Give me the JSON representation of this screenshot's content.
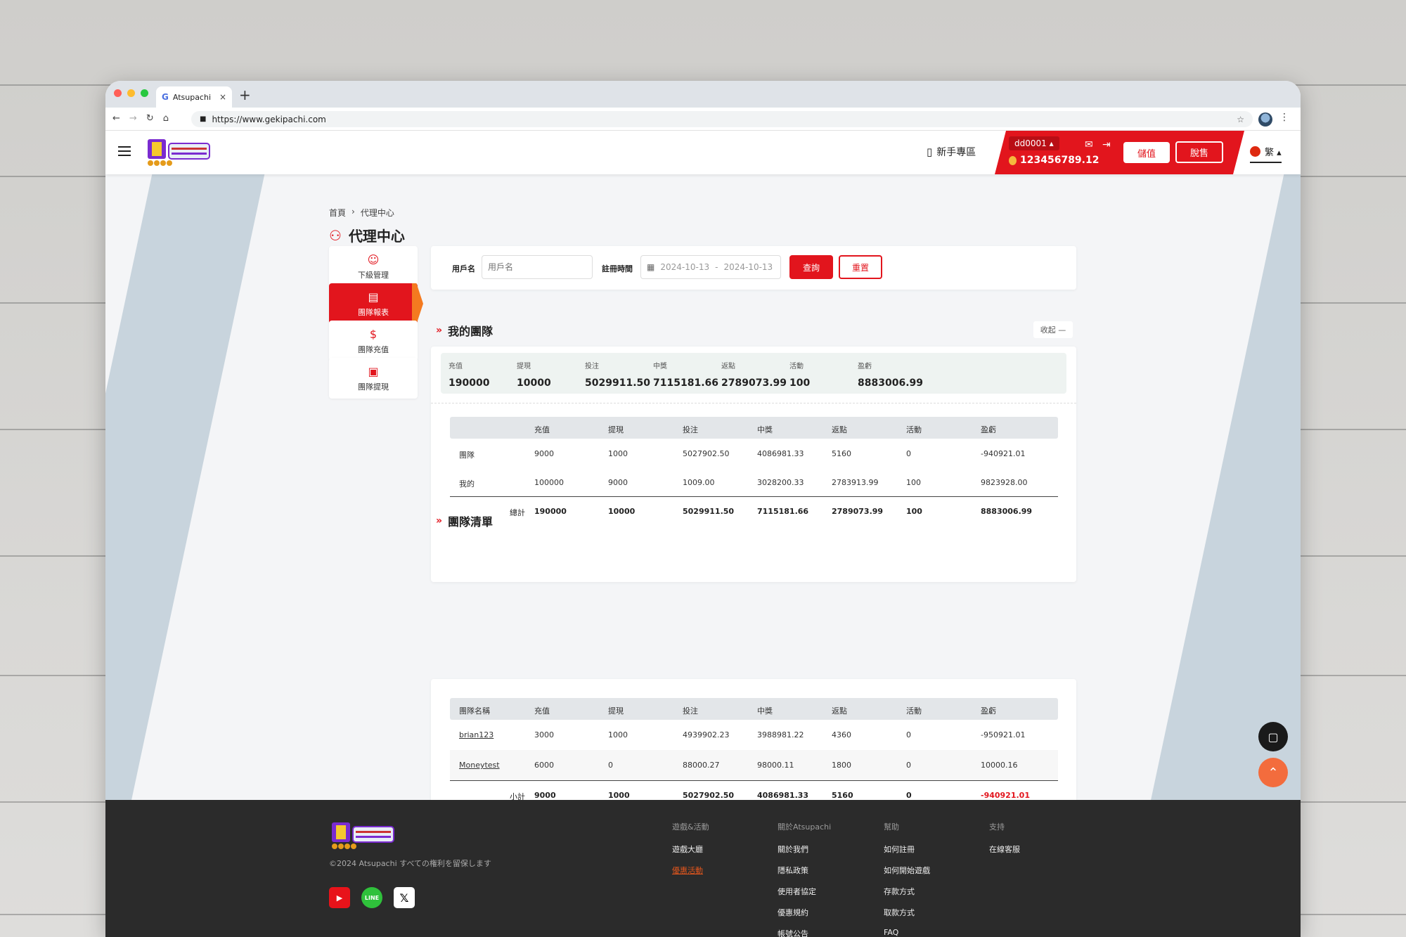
{
  "browser": {
    "tab_title": "Atsupachi",
    "tab_favicon": "G",
    "tab_close": "×",
    "new_tab": "+",
    "url": "https://www.gekipachi.com"
  },
  "header": {
    "newbie_label": "新手專區",
    "username": "dd0001 ▴",
    "balance": "123456789.12",
    "deposit_label": "儲值",
    "sell_label": "脫售",
    "lang_label": "繁 ▴",
    "accent_color": "#e2151d"
  },
  "breadcrumb": {
    "home": "首頁",
    "sep": "›",
    "current": "代理中心"
  },
  "page_title": "代理中心",
  "sidebar": {
    "items": [
      {
        "label": "下級管理",
        "icon": "users-icon",
        "active": false
      },
      {
        "label": "團隊報表",
        "icon": "document-icon",
        "active": true
      },
      {
        "label": "團隊充值",
        "icon": "moneybag-icon",
        "active": false
      },
      {
        "label": "團隊提現",
        "icon": "withdraw-icon",
        "active": false
      }
    ]
  },
  "filter": {
    "username_label": "用戶名",
    "username_placeholder": "用戶名",
    "time_label": "註冊時間",
    "date_start": "2024-10-13",
    "date_sep": "-",
    "date_end": "2024-10-13",
    "query_label": "查詢",
    "reset_label": "重置"
  },
  "my_team": {
    "title": "我的團隊",
    "collapse_label": "收起 —",
    "summary": [
      {
        "label": "充值",
        "value": "190000"
      },
      {
        "label": "提現",
        "value": "10000"
      },
      {
        "label": "投注",
        "value": "5029911.50"
      },
      {
        "label": "中獎",
        "value": "7115181.66"
      },
      {
        "label": "返點",
        "value": "2789073.99"
      },
      {
        "label": "活動",
        "value": "100"
      },
      {
        "label": "盈虧",
        "value": "8883006.99"
      }
    ],
    "columns": [
      "",
      "充值",
      "提現",
      "投注",
      "中獎",
      "返點",
      "活動",
      "盈虧"
    ],
    "rows": [
      [
        "團隊",
        "9000",
        "1000",
        "5027902.50",
        "4086981.33",
        "5160",
        "0",
        "-940921.01"
      ],
      [
        "我的",
        "100000",
        "9000",
        "1009.00",
        "3028200.33",
        "2783913.99",
        "100",
        "9823928.00"
      ]
    ],
    "total": [
      "總計",
      "190000",
      "10000",
      "5029911.50",
      "7115181.66",
      "2789073.99",
      "100",
      "8883006.99"
    ]
  },
  "team_list": {
    "title": "團隊清單",
    "columns": [
      "團隊名稱",
      "充值",
      "提現",
      "投注",
      "中獎",
      "返點",
      "活動",
      "盈虧"
    ],
    "rows": [
      [
        "brian123",
        "3000",
        "1000",
        "4939902.23",
        "3988981.22",
        "4360",
        "0",
        "-950921.01"
      ],
      [
        "Moneytest",
        "6000",
        "0",
        "88000.27",
        "98000.11",
        "1800",
        "0",
        "10000.16"
      ]
    ],
    "subtotal": [
      "小計",
      "9000",
      "1000",
      "5027902.50",
      "4086981.33",
      "5160",
      "0",
      "-940921.01"
    ]
  },
  "footer": {
    "copyright": "©2024 Atsupachi すべての権利を留保します",
    "social": [
      "youtube-icon",
      "line-icon",
      "x-icon"
    ],
    "line_text": "LINE",
    "columns": [
      {
        "heading": "遊戲&活動",
        "items": [
          "遊戲大廳",
          "優惠活動"
        ]
      },
      {
        "heading": "關於Atsupachi",
        "items": [
          "關於我們",
          "隱私政策",
          "使用者協定",
          "優惠規約",
          "帳號公告"
        ]
      },
      {
        "heading": "幫助",
        "items": [
          "如何註冊",
          "如何開始遊戲",
          "存款方式",
          "取款方式",
          "FAQ"
        ]
      },
      {
        "heading": "支持",
        "items": [
          "在線客服"
        ]
      }
    ]
  }
}
